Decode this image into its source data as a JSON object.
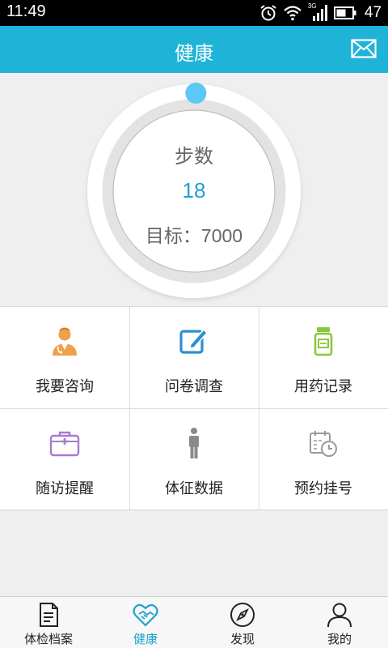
{
  "status_bar": {
    "time": "11:49",
    "network": "3G",
    "battery_level": "47",
    "icons": [
      "alarm-icon",
      "wifi-icon",
      "signal-icon",
      "battery-icon"
    ]
  },
  "header": {
    "title": "健康",
    "mail_icon": "mail-icon"
  },
  "steps": {
    "label": "步数",
    "value": "18",
    "goal_label": "目标：",
    "goal_value": "7000",
    "progress_fraction": 0.003
  },
  "features": [
    {
      "label": "我要咨询",
      "icon": "doctor-icon"
    },
    {
      "label": "问卷调查",
      "icon": "edit-icon"
    },
    {
      "label": "用药记录",
      "icon": "medicine-bottle-icon"
    },
    {
      "label": "随访提醒",
      "icon": "medical-kit-icon"
    },
    {
      "label": "体征数据",
      "icon": "person-icon"
    },
    {
      "label": "预约挂号",
      "icon": "calendar-clock-icon"
    }
  ],
  "nav": {
    "items": [
      {
        "label": "体检档案",
        "icon": "document-icon"
      },
      {
        "label": "健康",
        "icon": "heart-hands-icon"
      },
      {
        "label": "发现",
        "icon": "compass-icon"
      },
      {
        "label": "我的",
        "icon": "user-icon"
      }
    ],
    "active_index": 1
  },
  "colors": {
    "accent": "#1fb3d8",
    "accent_text": "#1fa2d0",
    "doctor": "#f0a04b",
    "edit": "#2a8fd0",
    "medicine": "#8cc63f",
    "kit": "#a67cd2",
    "person": "#8a8a8a",
    "calendar": "#9a9a9a"
  }
}
